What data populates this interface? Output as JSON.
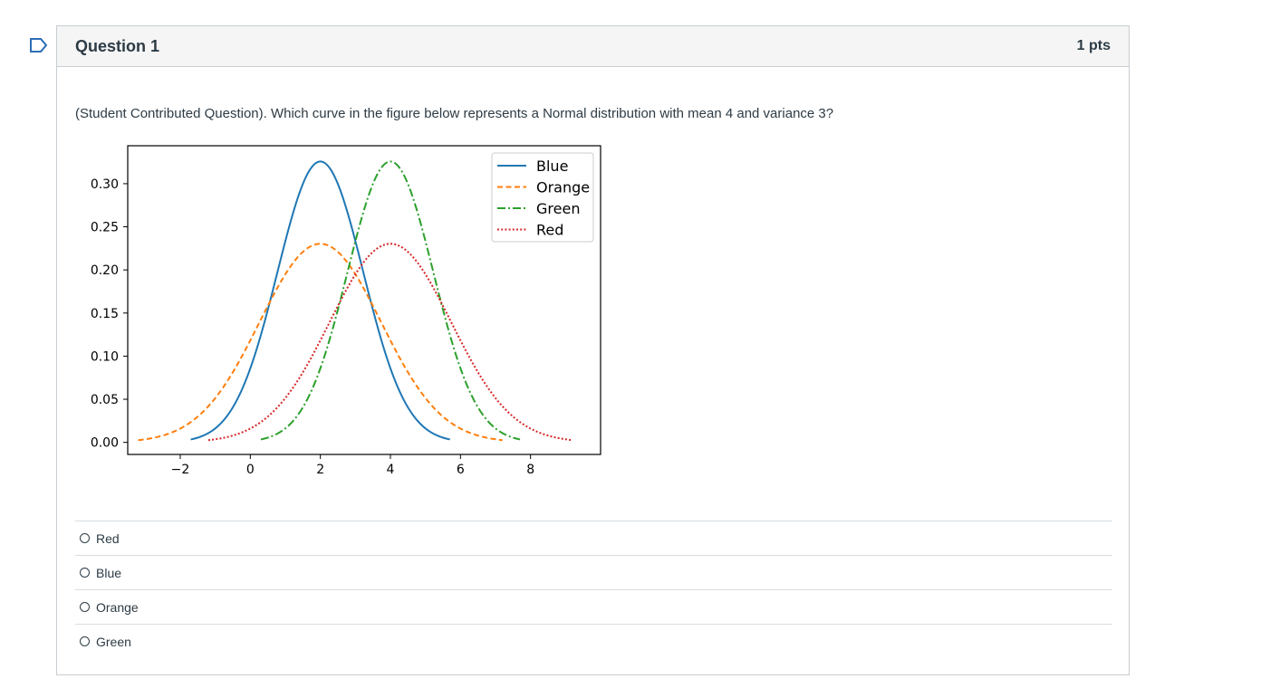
{
  "question": {
    "title": "Question 1",
    "points": "1 pts",
    "text": "(Student Contributed Question). Which curve in the figure below represents a Normal distribution with mean 4 and variance 3?"
  },
  "answers": [
    {
      "label": "Red"
    },
    {
      "label": "Blue"
    },
    {
      "label": "Orange"
    },
    {
      "label": "Green"
    }
  ],
  "icons": {
    "flag": "bookmark-flag-icon",
    "radio": "radio-unchecked-icon"
  },
  "colors": {
    "flag": "#2d6db5",
    "blue": "#1f77b4",
    "orange": "#ff7f0e",
    "green": "#2ca02c",
    "red": "#d62728"
  },
  "chart_data": {
    "type": "line",
    "title": "",
    "xlabel": "",
    "ylabel": "",
    "xlim": [
      -3.5,
      10.0
    ],
    "ylim": [
      -0.014,
      0.344
    ],
    "xticks": [
      -2,
      0,
      2,
      4,
      6,
      8
    ],
    "xtick_labels": [
      "−2",
      "0",
      "2",
      "4",
      "6",
      "8"
    ],
    "yticks": [
      0.0,
      0.05,
      0.1,
      0.15,
      0.2,
      0.25,
      0.3
    ],
    "ytick_labels": [
      "0.00",
      "0.05",
      "0.10",
      "0.15",
      "0.20",
      "0.25",
      "0.30"
    ],
    "legend_position": "top-right",
    "grid": false,
    "series": [
      {
        "name": "Blue",
        "color": "#1f77b4",
        "style": "solid",
        "mean": 2,
        "variance": 1.5,
        "x_range": [
          -1.7,
          5.7
        ]
      },
      {
        "name": "Orange",
        "color": "#ff7f0e",
        "style": "dashed",
        "mean": 2,
        "variance": 3,
        "x_range": [
          -3.2,
          7.2
        ]
      },
      {
        "name": "Green",
        "color": "#2ca02c",
        "style": "dashdot",
        "mean": 4,
        "variance": 1.5,
        "x_range": [
          0.3,
          7.7
        ]
      },
      {
        "name": "Red",
        "color": "#d62728",
        "style": "dotted",
        "mean": 4,
        "variance": 3,
        "x_range": [
          -1.2,
          9.2
        ]
      }
    ]
  }
}
